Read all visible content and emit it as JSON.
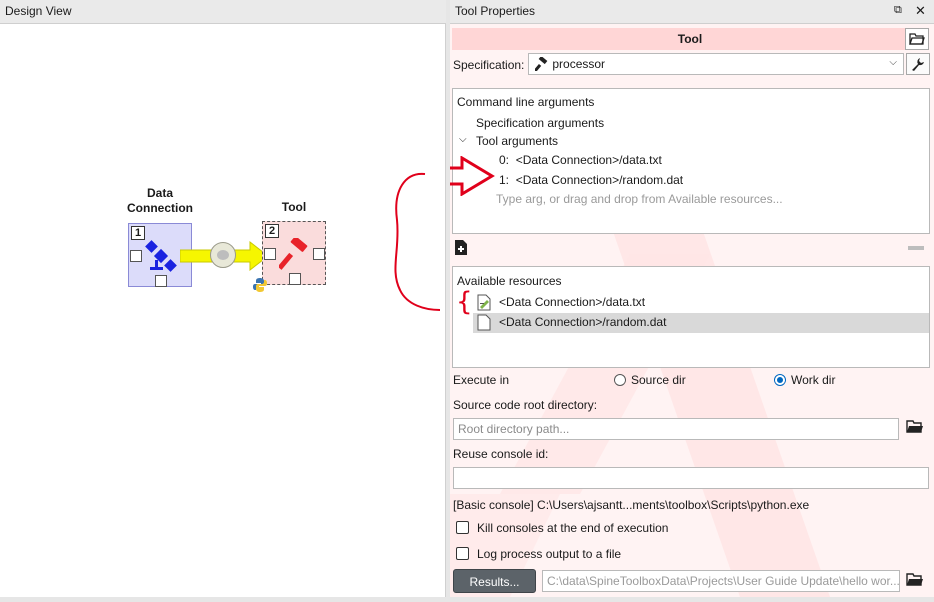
{
  "design_view": {
    "title": "Design View",
    "items": [
      {
        "name_line1": "Data",
        "name_line2": "Connection",
        "number": "1",
        "icon": "satellite-icon"
      },
      {
        "name": "Tool",
        "number": "2",
        "icon": "hammer-icon",
        "badge_icon": "python-icon"
      }
    ],
    "link_icon": "link-filter-icon"
  },
  "tool_properties": {
    "title": "Tool Properties",
    "header_buttons": [
      "float-icon",
      "close-icon"
    ],
    "item_name": "Tool",
    "specification_label": "Specification:",
    "specification_value": "processor",
    "command_line": {
      "title": "Command line arguments",
      "spec_args_label": "Specification arguments",
      "tool_args_label": "Tool arguments",
      "args": [
        {
          "index": "0:",
          "value": "<Data Connection>/data.txt"
        },
        {
          "index": "1:",
          "value": "<Data Connection>/random.dat"
        }
      ],
      "placeholder": "Type arg, or drag and drop from Available resources..."
    },
    "available_resources": {
      "title": "Available resources",
      "items": [
        "<Data Connection>/data.txt",
        "<Data Connection>/random.dat"
      ]
    },
    "execute_in": {
      "label": "Execute in",
      "options": [
        "Source dir",
        "Work dir"
      ],
      "selected": "Work dir"
    },
    "source_root": {
      "label": "Source code root directory:",
      "placeholder": "Root directory path..."
    },
    "reuse_console": {
      "label": "Reuse console id:",
      "value": ""
    },
    "kernel_info": "[Basic console] C:\\Users\\ajsantt...ments\\toolbox\\Scripts\\python.exe",
    "checkboxes": [
      {
        "label": "Kill consoles at the end of execution",
        "checked": false
      },
      {
        "label": "Log process output to a file",
        "checked": false
      }
    ],
    "results_button": "Results...",
    "results_path": "C:\\data\\SpineToolboxData\\Projects\\User Guide Update\\hello wor..."
  },
  "colors": {
    "accent_red": "#e0001b",
    "selection_blue": "#0067c0",
    "properties_bg": "#fff3f3",
    "dc_icon_blue": "#1a23e0",
    "tool_red": "#e8232a",
    "link_yellow": "#f6f600"
  }
}
